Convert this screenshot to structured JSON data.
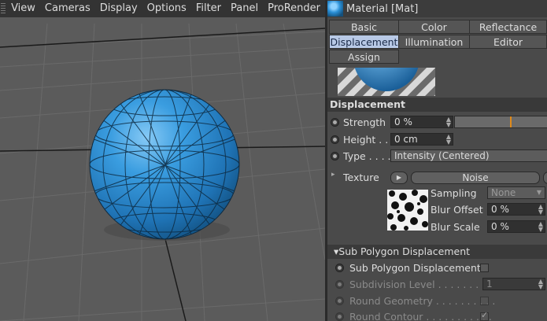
{
  "menu": [
    "View",
    "Cameras",
    "Display",
    "Options",
    "Filter",
    "Panel",
    "ProRender"
  ],
  "panel": {
    "title": "Material [Mat]",
    "tabs": [
      "Basic",
      "Color",
      "Reflectance",
      "Displacement",
      "Illumination",
      "Editor",
      "Assign"
    ],
    "active_tab": "Displacement",
    "section_displacement": "Displacement",
    "strength_label": "Strength",
    "strength_value": "0 %",
    "height_label": "Height . .",
    "height_value": "0 cm",
    "type_label": "Type . . . .",
    "type_value": "Intensity (Centered)",
    "texture_label": "Texture",
    "texture_button": "Noise",
    "sampling_label": "Sampling",
    "sampling_value": "None",
    "blur_offset_label": "Blur Offset",
    "blur_offset_value": "0 %",
    "blur_scale_label": "Blur Scale",
    "blur_scale_value": "0 %",
    "section_subpoly": "▾Sub Polygon Displacement",
    "subpoly_label": "Sub Polygon Displacement",
    "subdiv_label": "Subdivision Level . . . . . . . . . .",
    "subdiv_value": "1",
    "round_geom_label": "Round Geometry . . . . . . . . . .",
    "round_contour_label": "Round Contour . . . . . . . . . . ."
  },
  "colors": {
    "sphere": "#2a8fd6",
    "accent": "#e08a1a",
    "active_tab": "#b8c9e6"
  }
}
